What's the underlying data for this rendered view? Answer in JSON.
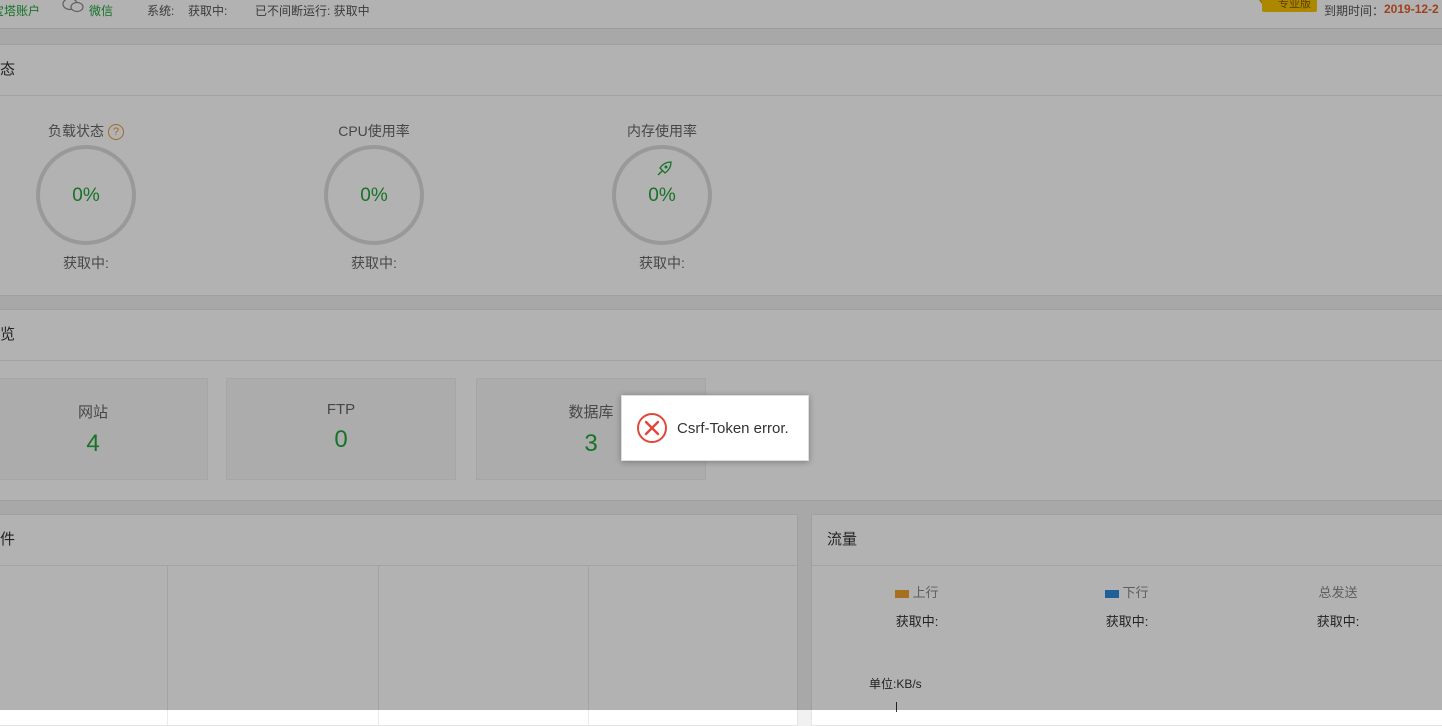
{
  "topbar": {
    "account_text": "宝塔账户",
    "wechat_label": "微信",
    "system_label": "系统:",
    "system_value": "获取中:",
    "uptime_text": "已不间断运行: 获取中",
    "edition_badge": "专业版",
    "expire_label": "到期时间：",
    "expire_value": "2019-12-2"
  },
  "status_panel": {
    "title": "状态",
    "gauges": [
      {
        "label": "负载状态",
        "value": "0%",
        "status": "获取中:",
        "icon": "help-icon"
      },
      {
        "label": "CPU使用率",
        "value": "0%",
        "status": "获取中:"
      },
      {
        "label": "内存使用率",
        "value": "0%",
        "status": "获取中:",
        "icon": "rocket-icon"
      }
    ]
  },
  "overview_panel": {
    "title": "概览",
    "boxes": [
      {
        "name": "网站",
        "count": "4"
      },
      {
        "name": "FTP",
        "count": "0"
      },
      {
        "name": "数据库",
        "count": "3"
      }
    ]
  },
  "software_panel": {
    "title": "软件"
  },
  "traffic_panel": {
    "title": "流量",
    "upload_label": "上行",
    "upload_value": "获取中:",
    "download_label": "下行",
    "download_value": "获取中:",
    "total_sent_label": "总发送",
    "total_sent_value": "获取中:",
    "unit_label": "单位:KB/s",
    "colors": {
      "upload": "#f0a030",
      "download": "#2f89d8"
    }
  },
  "toast": {
    "message": "Csrf-Token error.",
    "icon": "error-circle-icon",
    "color": "#e0483a"
  }
}
